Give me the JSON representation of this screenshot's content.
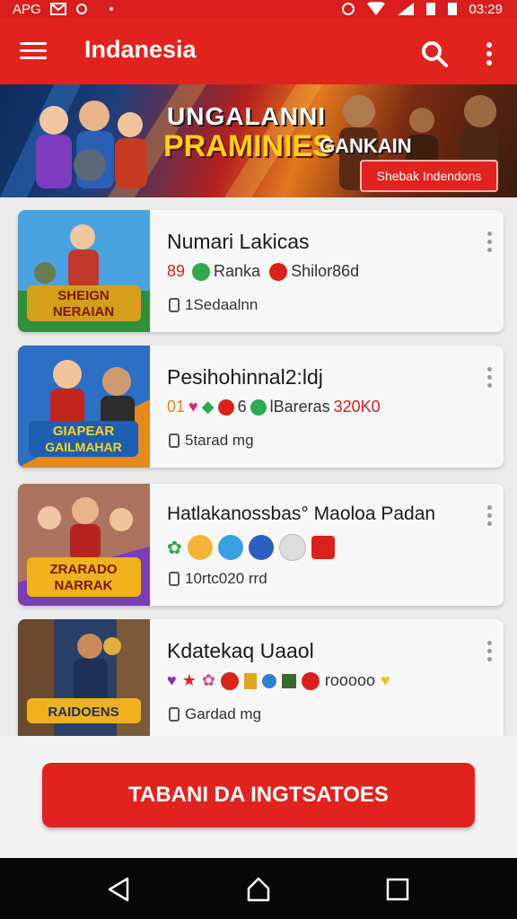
{
  "status_bar": {
    "left_text": "APG",
    "time": "03:29"
  },
  "app_bar": {
    "title": "Indanesia"
  },
  "banner": {
    "line1": "UNGALANNI",
    "line2": "PRAMINIES",
    "line3": "GANKAIN",
    "button_label": "Shebak Indendons"
  },
  "items": [
    {
      "title": "Numari Lakicas",
      "meta": [
        "89",
        "Ranka",
        "Shilor86d"
      ],
      "size": "1Sedaalnn",
      "thumb_text": "SHEIGN NERAIAN",
      "thumb_colors": [
        "#4aa3df",
        "#2f8f3a",
        "#c0392b"
      ]
    },
    {
      "title": "Pesihohinnal2:ldj",
      "meta": [
        "01",
        "6",
        "lBareras",
        "320K0"
      ],
      "size": "5tarad mg",
      "thumb_text": "GIAPEAR GAILMAHAR",
      "thumb_colors": [
        "#2d6fc4",
        "#e38a1f",
        "#c0261f"
      ]
    },
    {
      "title": "Hatlakanossbas° Maoloa Padan",
      "meta": [],
      "size": "10rtc020 rrd",
      "thumb_text": "ZRARADO NARRAK",
      "thumb_colors": [
        "#7a3db3",
        "#d6a21c",
        "#b5251e"
      ]
    },
    {
      "title": "Kdatekaq Uaaol",
      "meta": [
        "rooooo"
      ],
      "size": "Gardad mg",
      "thumb_text": "RAIDOENS",
      "thumb_colors": [
        "#2c3f66",
        "#c86d2a",
        "#3a2a1e"
      ]
    }
  ],
  "cta": {
    "label": "TABANI DA INGTSATOES"
  },
  "colors": {
    "primary": "#e0231f",
    "accent": "#ffcf1a"
  }
}
